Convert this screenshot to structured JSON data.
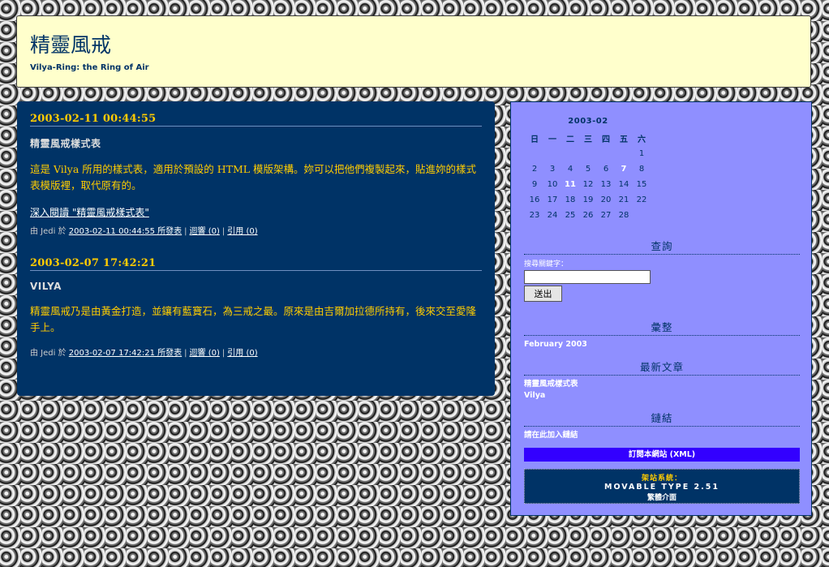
{
  "colors": {
    "accent": "#ffcc00",
    "main_bg": "#003366",
    "sidebar_bg": "#8f8fff",
    "banner_bg": "#ffffcc",
    "xml_bar": "#3300ff"
  },
  "banner": {
    "title": "精靈風戒",
    "description": "Vilya-Ring: the Ring of Air"
  },
  "posts": [
    {
      "date": "2003-02-11 00:44:55",
      "title": "精靈風戒樣式表",
      "body": "這是 Vilya 所用的樣式表，適用於預設的 HTML 模版架構。妳可以把他們複製起來，貼進妳的樣式表模版裡，取代原有的。",
      "more": "深入閱讀 \"精靈風戒樣式表\"",
      "author_prefix": "由 Jedi 於",
      "permalink": "2003-02-11 00:44:55 所發表",
      "comments": "迴響 (0)",
      "trackback": "引用 (0)"
    },
    {
      "date": "2003-02-07 17:42:21",
      "title": "VILYA",
      "body": "精靈風戒乃是由黃金打造，並鑲有藍寶石，為三戒之最。原來是由吉爾加拉德所持有，後來交至愛隆手上。",
      "author_prefix": "由 Jedi 於",
      "permalink": "2003-02-07 17:42:21 所發表",
      "comments": "迴響 (0)",
      "trackback": "引用 (0)"
    }
  ],
  "calendar": {
    "caption": "2003-02",
    "weekdays": [
      "日",
      "一",
      "二",
      "三",
      "四",
      "五",
      "六"
    ],
    "weeks": [
      [
        "",
        "",
        "",
        "",
        "",
        "",
        "1"
      ],
      [
        "2",
        "3",
        "4",
        "5",
        "6",
        "7",
        "8"
      ],
      [
        "9",
        "10",
        "11",
        "12",
        "13",
        "14",
        "15"
      ],
      [
        "16",
        "17",
        "18",
        "19",
        "20",
        "21",
        "22"
      ],
      [
        "23",
        "24",
        "25",
        "26",
        "27",
        "28",
        ""
      ]
    ],
    "linked_days": [
      "7",
      "11"
    ]
  },
  "search": {
    "title": "查詢",
    "label": "搜尋關鍵字：",
    "value": "",
    "button": "送出"
  },
  "archives": {
    "title": "彙整",
    "items": [
      "February 2003"
    ]
  },
  "recent": {
    "title": "最新文章",
    "items": [
      "精靈風戒樣式表",
      "Vilya"
    ]
  },
  "links": {
    "title": "鏈結",
    "items": [
      "請在此加入鏈結"
    ]
  },
  "xml_feed": "訂閱本網站 (XML)",
  "powered": {
    "line1": "架站系統：",
    "line2": "MOVABLE TYPE 2.51",
    "line3": "繁體介面"
  }
}
